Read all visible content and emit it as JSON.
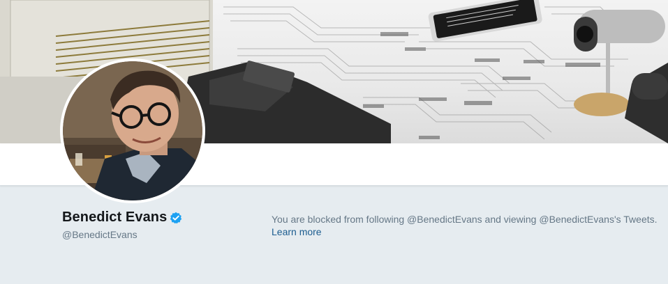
{
  "profile": {
    "name": "Benedict Evans",
    "handle": "@BenedictEvans",
    "verified": true
  },
  "blocked_notice": {
    "message": "You are blocked from following @BenedictEvans and viewing @BenedictEvans's Tweets.",
    "learn_more_label": "Learn more"
  },
  "colors": {
    "page_background": "#e6ecf0",
    "name": "#14171a",
    "secondary_text": "#657786",
    "link": "#1b5c8f",
    "verified_badge": "#1da1f2"
  }
}
